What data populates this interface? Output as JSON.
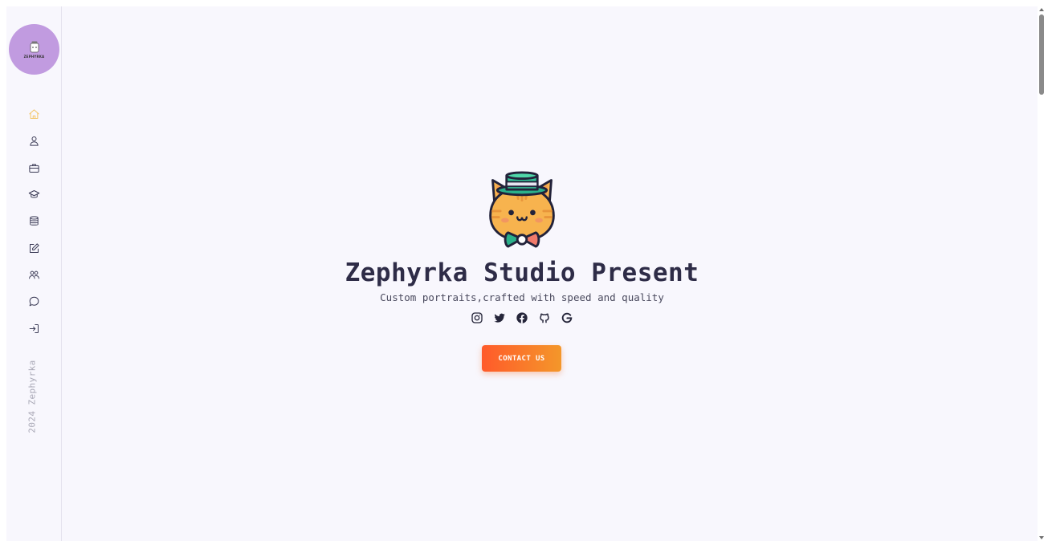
{
  "sidebar": {
    "logo_text": "ZEPHYRKA",
    "nav_items": [
      {
        "icon": "home-icon",
        "active": true
      },
      {
        "icon": "user-icon",
        "active": false
      },
      {
        "icon": "briefcase-icon",
        "active": false
      },
      {
        "icon": "graduation-cap-icon",
        "active": false
      },
      {
        "icon": "database-icon",
        "active": false
      },
      {
        "icon": "edit-icon",
        "active": false
      },
      {
        "icon": "users-icon",
        "active": false
      },
      {
        "icon": "chat-icon",
        "active": false
      },
      {
        "icon": "sign-in-icon",
        "active": false
      }
    ],
    "copyright": "2024 Zephyrka"
  },
  "hero": {
    "avatar": "cat-with-top-hat-and-bowtie",
    "title": "Zephyrka Studio Present",
    "subtitle": "Custom portraits,crafted with speed and quality",
    "socials": [
      "instagram-icon",
      "twitter-icon",
      "facebook-icon",
      "github-icon",
      "google-icon"
    ],
    "cta_label": "CONTACT US"
  },
  "colors": {
    "background": "#f8f7fd",
    "logo_circle": "#c19be0",
    "active_nav": "#f3c566",
    "nav_icon": "#3a3a55",
    "title_text": "#2e2c47",
    "cta_gradient_start": "#ff5a2a",
    "cta_gradient_end": "#f4972a"
  }
}
